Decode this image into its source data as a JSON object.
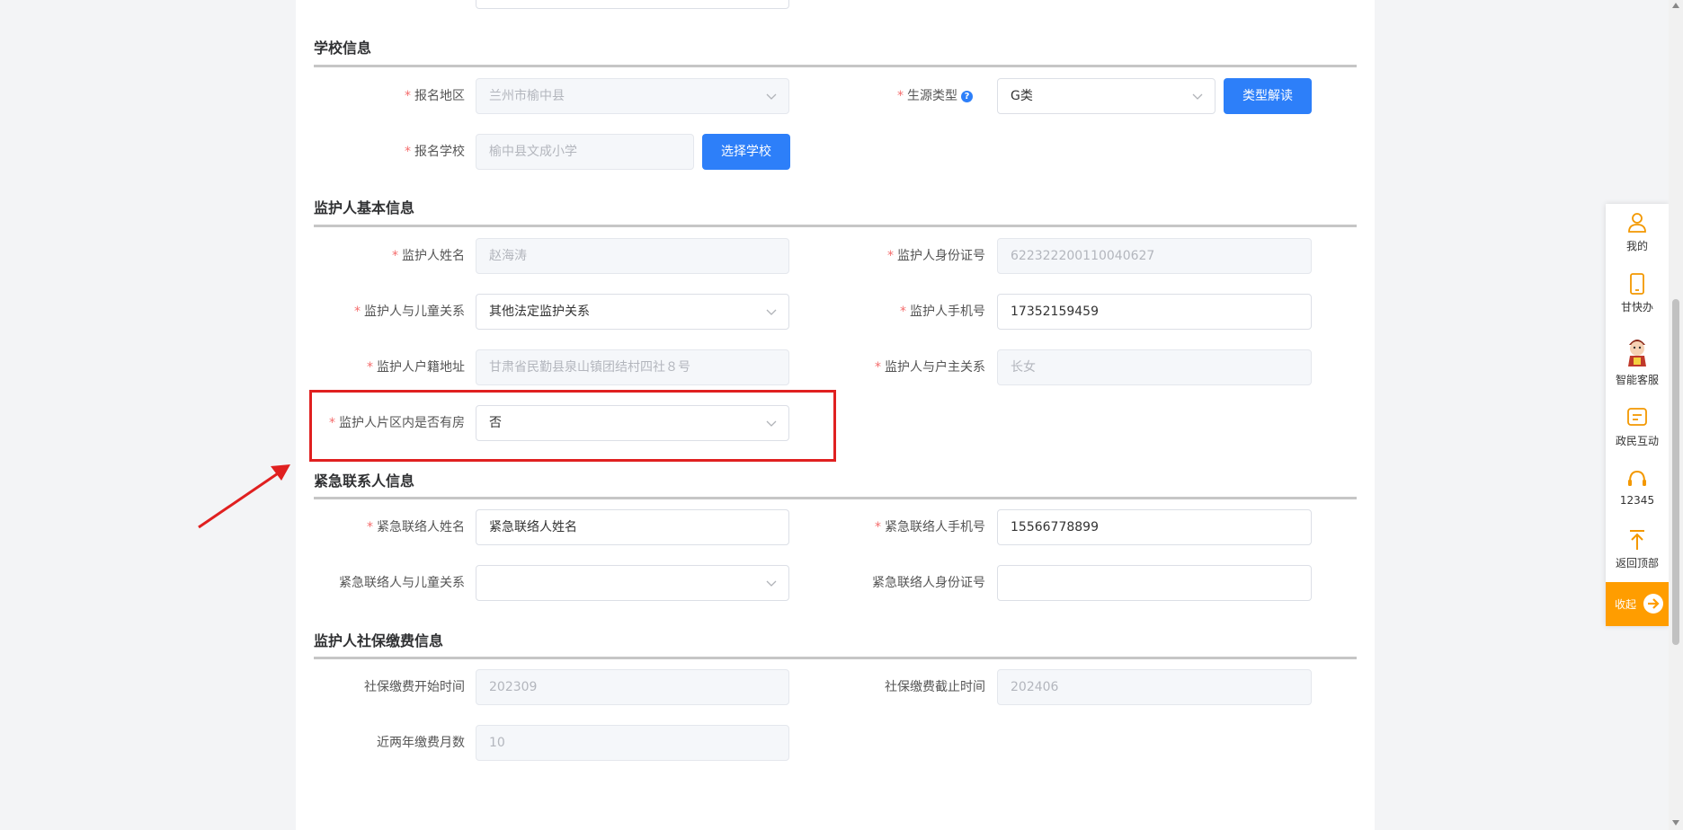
{
  "sections": {
    "school": {
      "title": "学校信息"
    },
    "guardian": {
      "title": "监护人基本信息"
    },
    "emergency": {
      "title": "紧急联系人信息"
    },
    "social": {
      "title": "监护人社保缴费信息"
    }
  },
  "school": {
    "region_label": "报名地区",
    "region_value": "兰州市榆中县",
    "source_type_label": "生源类型",
    "source_type_value": "G类",
    "type_explain_button": "类型解读",
    "school_label": "报名学校",
    "school_value": "榆中县文成小学",
    "choose_school_button": "选择学校"
  },
  "guardian": {
    "name_label": "监护人姓名",
    "name_value": "赵海涛",
    "id_label": "监护人身份证号",
    "id_value": "622322200110040627",
    "relation_label": "监护人与儿童关系",
    "relation_value": "其他法定监护关系",
    "phone_label": "监护人手机号",
    "phone_value": "17352159459",
    "address_label": "监护人户籍地址",
    "address_value": "甘肃省民勤县泉山镇团结村四社８号",
    "household_label": "监护人与户主关系",
    "household_value": "长女",
    "house_label": "监护人片区内是否有房",
    "house_value": "否"
  },
  "emergency": {
    "name_label": "紧急联络人姓名",
    "name_value": "紧急联络人姓名",
    "phone_label": "紧急联络人手机号",
    "phone_value": "15566778899",
    "relation_label": "紧急联络人与儿童关系",
    "relation_value": "",
    "id_label": "紧急联络人身份证号",
    "id_value": ""
  },
  "social": {
    "start_label": "社保缴费开始时间",
    "start_value": "202309",
    "end_label": "社保缴费截止时间",
    "end_value": "202406",
    "months_label": "近两年缴费月数",
    "months_value": "10"
  },
  "required_mark": "*",
  "sidebar": {
    "items": [
      {
        "label": "我的",
        "icon": "user-icon"
      },
      {
        "label": "甘快办",
        "icon": "phone-icon"
      },
      {
        "label": "智能客服",
        "icon": "mascot-icon"
      },
      {
        "label": "政民互动",
        "icon": "message-icon"
      },
      {
        "label": "12345",
        "icon": "headset-icon"
      },
      {
        "label": "返回顶部",
        "icon": "arrow-up-icon"
      }
    ],
    "collapse_label": "收起"
  },
  "colors": {
    "primary": "#2d7ff9",
    "highlight": "#e02020",
    "sidebar_accent": "#ff9d00",
    "required": "#f56c6c"
  }
}
